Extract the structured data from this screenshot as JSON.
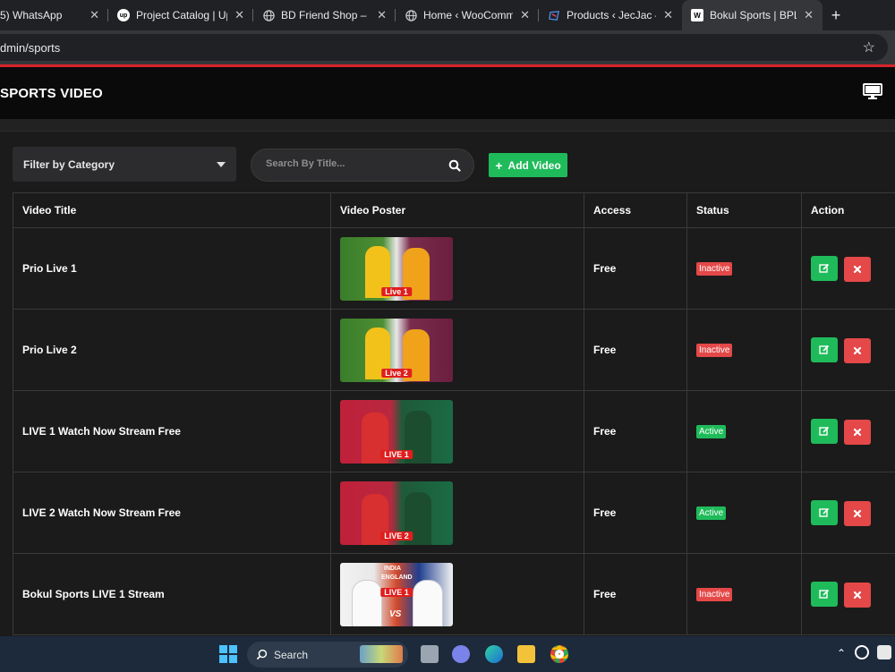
{
  "browser": {
    "tabs": [
      {
        "title": "5) WhatsApp",
        "favicon": "whatsapp-icon",
        "active": false
      },
      {
        "title": "Project Catalog | Upwork",
        "favicon": "upwork-icon",
        "active": false
      },
      {
        "title": "BD Friend Shop – Your",
        "favicon": "globe-icon",
        "active": false
      },
      {
        "title": "Home ‹ WooCommerce",
        "favicon": "globe-icon",
        "active": false
      },
      {
        "title": "Products ‹ JecJac — W",
        "favicon": "wordpress-icon",
        "active": false
      },
      {
        "title": "Bokul Sports | BPL LIVE",
        "favicon": "bokul-icon",
        "active": true
      }
    ],
    "new_tab_label": "+",
    "tab_close_glyph": "✕",
    "url": "dmin/sports",
    "star_glyph": "☆"
  },
  "header": {
    "title": "SPORTS VIDEO",
    "icon": "monitor-icon"
  },
  "controls": {
    "filter_label": "Filter by Category",
    "search_placeholder": "Search By Title...",
    "add_button_label": "Add Video",
    "add_button_icon": "+"
  },
  "table": {
    "columns": [
      "Video Title",
      "Video Poster",
      "Access",
      "Status",
      "Action"
    ],
    "rows": [
      {
        "title": "Prio Live 1",
        "poster_label": "Live 1",
        "poster_theme": "aus-wi",
        "access": "Free",
        "status": "Inactive"
      },
      {
        "title": "Prio Live 2",
        "poster_label": "Live 2",
        "poster_theme": "aus-wi",
        "access": "Free",
        "status": "Inactive"
      },
      {
        "title": "LIVE 1 Watch Now Stream Free",
        "poster_label": "LIVE 1",
        "poster_theme": "ban-pak",
        "access": "Free",
        "status": "Active"
      },
      {
        "title": "LIVE 2 Watch Now Stream Free",
        "poster_label": "LIVE 2",
        "poster_theme": "ban-pak",
        "access": "Free",
        "status": "Active"
      },
      {
        "title": "Bokul Sports LIVE 1 Stream",
        "poster_label": "LIVE 1",
        "poster_theme": "ind-eng",
        "access": "Free",
        "status": "Inactive"
      }
    ]
  },
  "poster_text": {
    "india": "INDIA",
    "england": "ENGLAND",
    "vs": "VS"
  },
  "colors": {
    "accent_red": "#d7232b",
    "success": "#1fbb5a",
    "danger": "#e44848"
  },
  "taskbar": {
    "search_label": "Search"
  }
}
